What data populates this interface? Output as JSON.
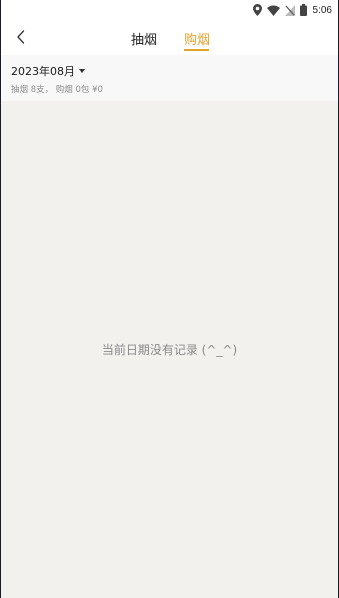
{
  "status_bar": {
    "time": "5:06",
    "icons": [
      "location-icon",
      "wifi-icon",
      "no-sim-icon",
      "battery-icon"
    ]
  },
  "header": {
    "back_icon": "chevron-left-icon",
    "tabs": [
      {
        "label": "抽烟",
        "active": false
      },
      {
        "label": "购烟",
        "active": true
      }
    ],
    "accent_color": "#e1a22b"
  },
  "summary": {
    "month": "2023年08月",
    "stats": "抽烟 8支， 购烟 0包 ¥0"
  },
  "empty_state": {
    "message": "当前日期没有记录 (^_^)"
  }
}
